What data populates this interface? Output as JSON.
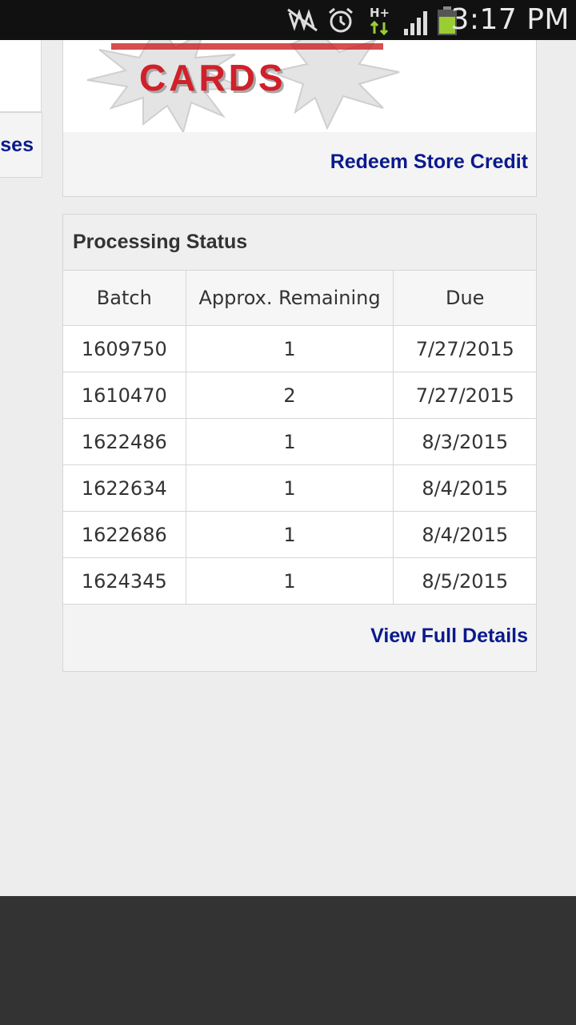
{
  "status_bar": {
    "time": "3:17 PM",
    "network_label": "H+",
    "icons": [
      "mute-icon",
      "alarm-icon",
      "network-hplus-icon",
      "signal-icon",
      "battery-icon"
    ]
  },
  "sidebar": {
    "link_fragment": "ses"
  },
  "promo": {
    "logo_text": "CARDS",
    "redeem_label": "Redeem Store Credit"
  },
  "processing": {
    "title": "Processing Status",
    "columns": [
      "Batch",
      "Approx. Remaining",
      "Due"
    ],
    "rows": [
      [
        "1609750",
        "1",
        "7/27/2015"
      ],
      [
        "1610470",
        "2",
        "7/27/2015"
      ],
      [
        "1622486",
        "1",
        "8/3/2015"
      ],
      [
        "1622634",
        "1",
        "8/4/2015"
      ],
      [
        "1622686",
        "1",
        "8/4/2015"
      ],
      [
        "1624345",
        "1",
        "8/5/2015"
      ]
    ],
    "details_label": "View Full Details"
  },
  "colors": {
    "link": "#0a1a8c",
    "logo_red": "#d0202a",
    "footer_bg": "#333333",
    "page_bg": "#ededed"
  }
}
